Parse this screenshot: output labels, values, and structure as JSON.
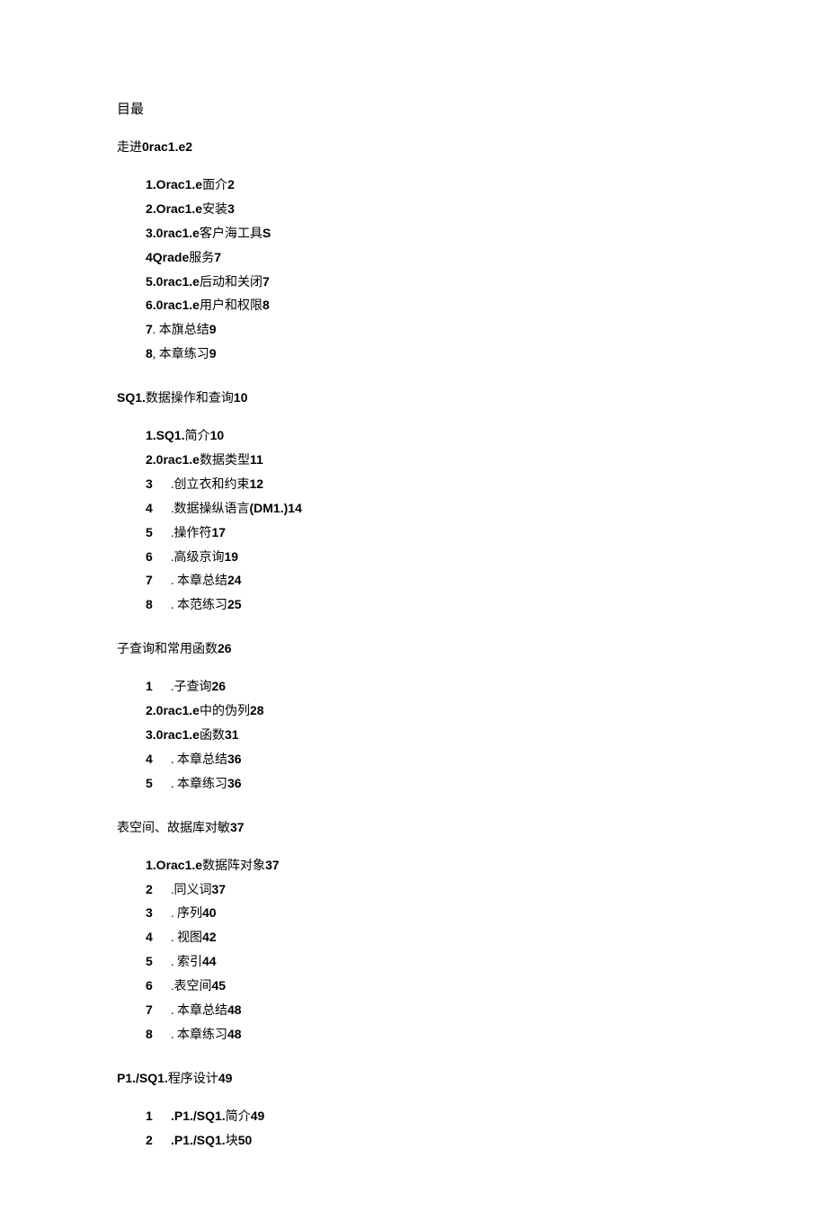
{
  "title": "目最",
  "sections": [
    {
      "heading": {
        "prefix": "走进",
        "bold": "0rac1.e2"
      },
      "items": [
        {
          "num": "1.Orac1.e",
          "txt": "面介",
          "page": "2",
          "wide": false
        },
        {
          "num": "2.Orac1.e",
          "txt": "安装",
          "page": "3",
          "wide": false
        },
        {
          "num": "3.0rac1.e",
          "txt": "客户海工具",
          "page": "S",
          "wide": false
        },
        {
          "num": "4Qrade",
          "txt": "服务",
          "page": "7",
          "wide": false
        },
        {
          "num": "5.0rac1.e",
          "txt": "后动和关闭",
          "page": "7",
          "wide": false
        },
        {
          "num": "6.0rac1.e",
          "txt": "用户和权限",
          "page": "8",
          "wide": false
        },
        {
          "num": "7",
          "txt": ". 本旗总结",
          "page": "9",
          "wide": false
        },
        {
          "num": "8",
          "txt": ", 本章练习",
          "page": "9",
          "wide": false
        }
      ]
    },
    {
      "heading": {
        "prefix": "",
        "bold": "SQ1.",
        "suffix": "数据操作和查询",
        "boldpage": "10"
      },
      "items": [
        {
          "num": "1.SQ1.",
          "txt": "简介",
          "page": "10",
          "wide": false
        },
        {
          "num": "2.0rac1.e",
          "txt": "数据类型",
          "page": "11",
          "wide": false
        },
        {
          "num": "3",
          "txt": ".创立衣和约束",
          "page": "12",
          "wide": true
        },
        {
          "num": "4",
          "txt": ".数据操纵语言",
          "mid": "(DM1.)",
          "page": "14",
          "wide": true
        },
        {
          "num": "5",
          "txt": ".操作符",
          "page": "17",
          "wide": true
        },
        {
          "num": "6",
          "txt": ".高级京询",
          "page": "19",
          "wide": true
        },
        {
          "num": "7",
          "txt": ". 本章总结",
          "page": "24",
          "wide": true
        },
        {
          "num": "8",
          "txt": ". 本范练习",
          "page": "25",
          "wide": true
        }
      ]
    },
    {
      "heading": {
        "prefix": "子查询和常用函数",
        "bold": "26"
      },
      "items": [
        {
          "num": "1",
          "txt": ".子查询",
          "page": "26",
          "wide": true
        },
        {
          "num": "2.0rac1.e",
          "txt": "中的伪列",
          "page": "28",
          "wide": false
        },
        {
          "num": "3.0rac1.e",
          "txt": "函数",
          "page": "31",
          "wide": false
        },
        {
          "num": "4",
          "txt": ". 本章总结",
          "page": "36",
          "wide": true
        },
        {
          "num": "5",
          "txt": ". 本章练习",
          "page": "36",
          "wide": true
        }
      ]
    },
    {
      "heading": {
        "prefix": "表空间、故据库对敏",
        "bold": "37"
      },
      "items": [
        {
          "num": "1.Orac1.e",
          "txt": "数据阵对象",
          "page": "37",
          "wide": false
        },
        {
          "num": "2",
          "txt": ".同义词",
          "page": "37",
          "wide": true
        },
        {
          "num": "3",
          "txt": ". 序列",
          "page": "40",
          "wide": true
        },
        {
          "num": "4",
          "txt": ". 视图",
          "page": "42",
          "wide": true
        },
        {
          "num": "5",
          "txt": ". 索引",
          "page": "44",
          "wide": true
        },
        {
          "num": "6",
          "txt": ".表空间",
          "page": "45",
          "wide": true
        },
        {
          "num": "7",
          "txt": ". 本章总结",
          "page": "48",
          "wide": true
        },
        {
          "num": "8",
          "txt": ". 本章练习",
          "page": "48",
          "wide": true
        }
      ]
    },
    {
      "heading": {
        "prefix": "",
        "bold": "P1./SQ1.",
        "suffix": "程序设计",
        "boldpage": "49"
      },
      "items": [
        {
          "num": "1",
          "txt": "",
          "mid": ".P1./SQ1.",
          "txt2": "简介",
          "page": "49",
          "wide": true
        },
        {
          "num": "2",
          "txt": "",
          "mid": ".P1./SQ1.",
          "txt2": "块",
          "page": "50",
          "wide": true
        }
      ]
    }
  ]
}
